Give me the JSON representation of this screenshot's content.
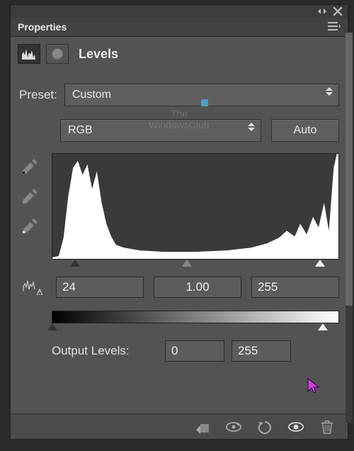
{
  "panel": {
    "title": "Properties",
    "adjustment": "Levels"
  },
  "preset": {
    "label": "Preset:",
    "value": "Custom"
  },
  "channel": {
    "value": "RGB",
    "auto_label": "Auto"
  },
  "input_levels": {
    "black": "24",
    "mid": "1.00",
    "white": "255"
  },
  "output": {
    "label": "Output Levels:",
    "black": "0",
    "white": "255"
  },
  "watermark": {
    "line1": "The",
    "line2": "WindowsClub"
  },
  "icons": {
    "collapse": "collapse-arrows-icon",
    "close": "close-icon",
    "menu": "menu-icon",
    "levels": "levels-icon",
    "mask": "mask-icon",
    "clip": "clip-to-layer-icon",
    "view_prev": "view-previous-icon",
    "reset": "reset-icon",
    "visibility": "visibility-icon",
    "trash": "trash-icon",
    "warn": "warning-icon",
    "eyedropper_black": "eyedropper-black-icon",
    "eyedropper_gray": "eyedropper-gray-icon",
    "eyedropper_white": "eyedropper-white-icon"
  }
}
